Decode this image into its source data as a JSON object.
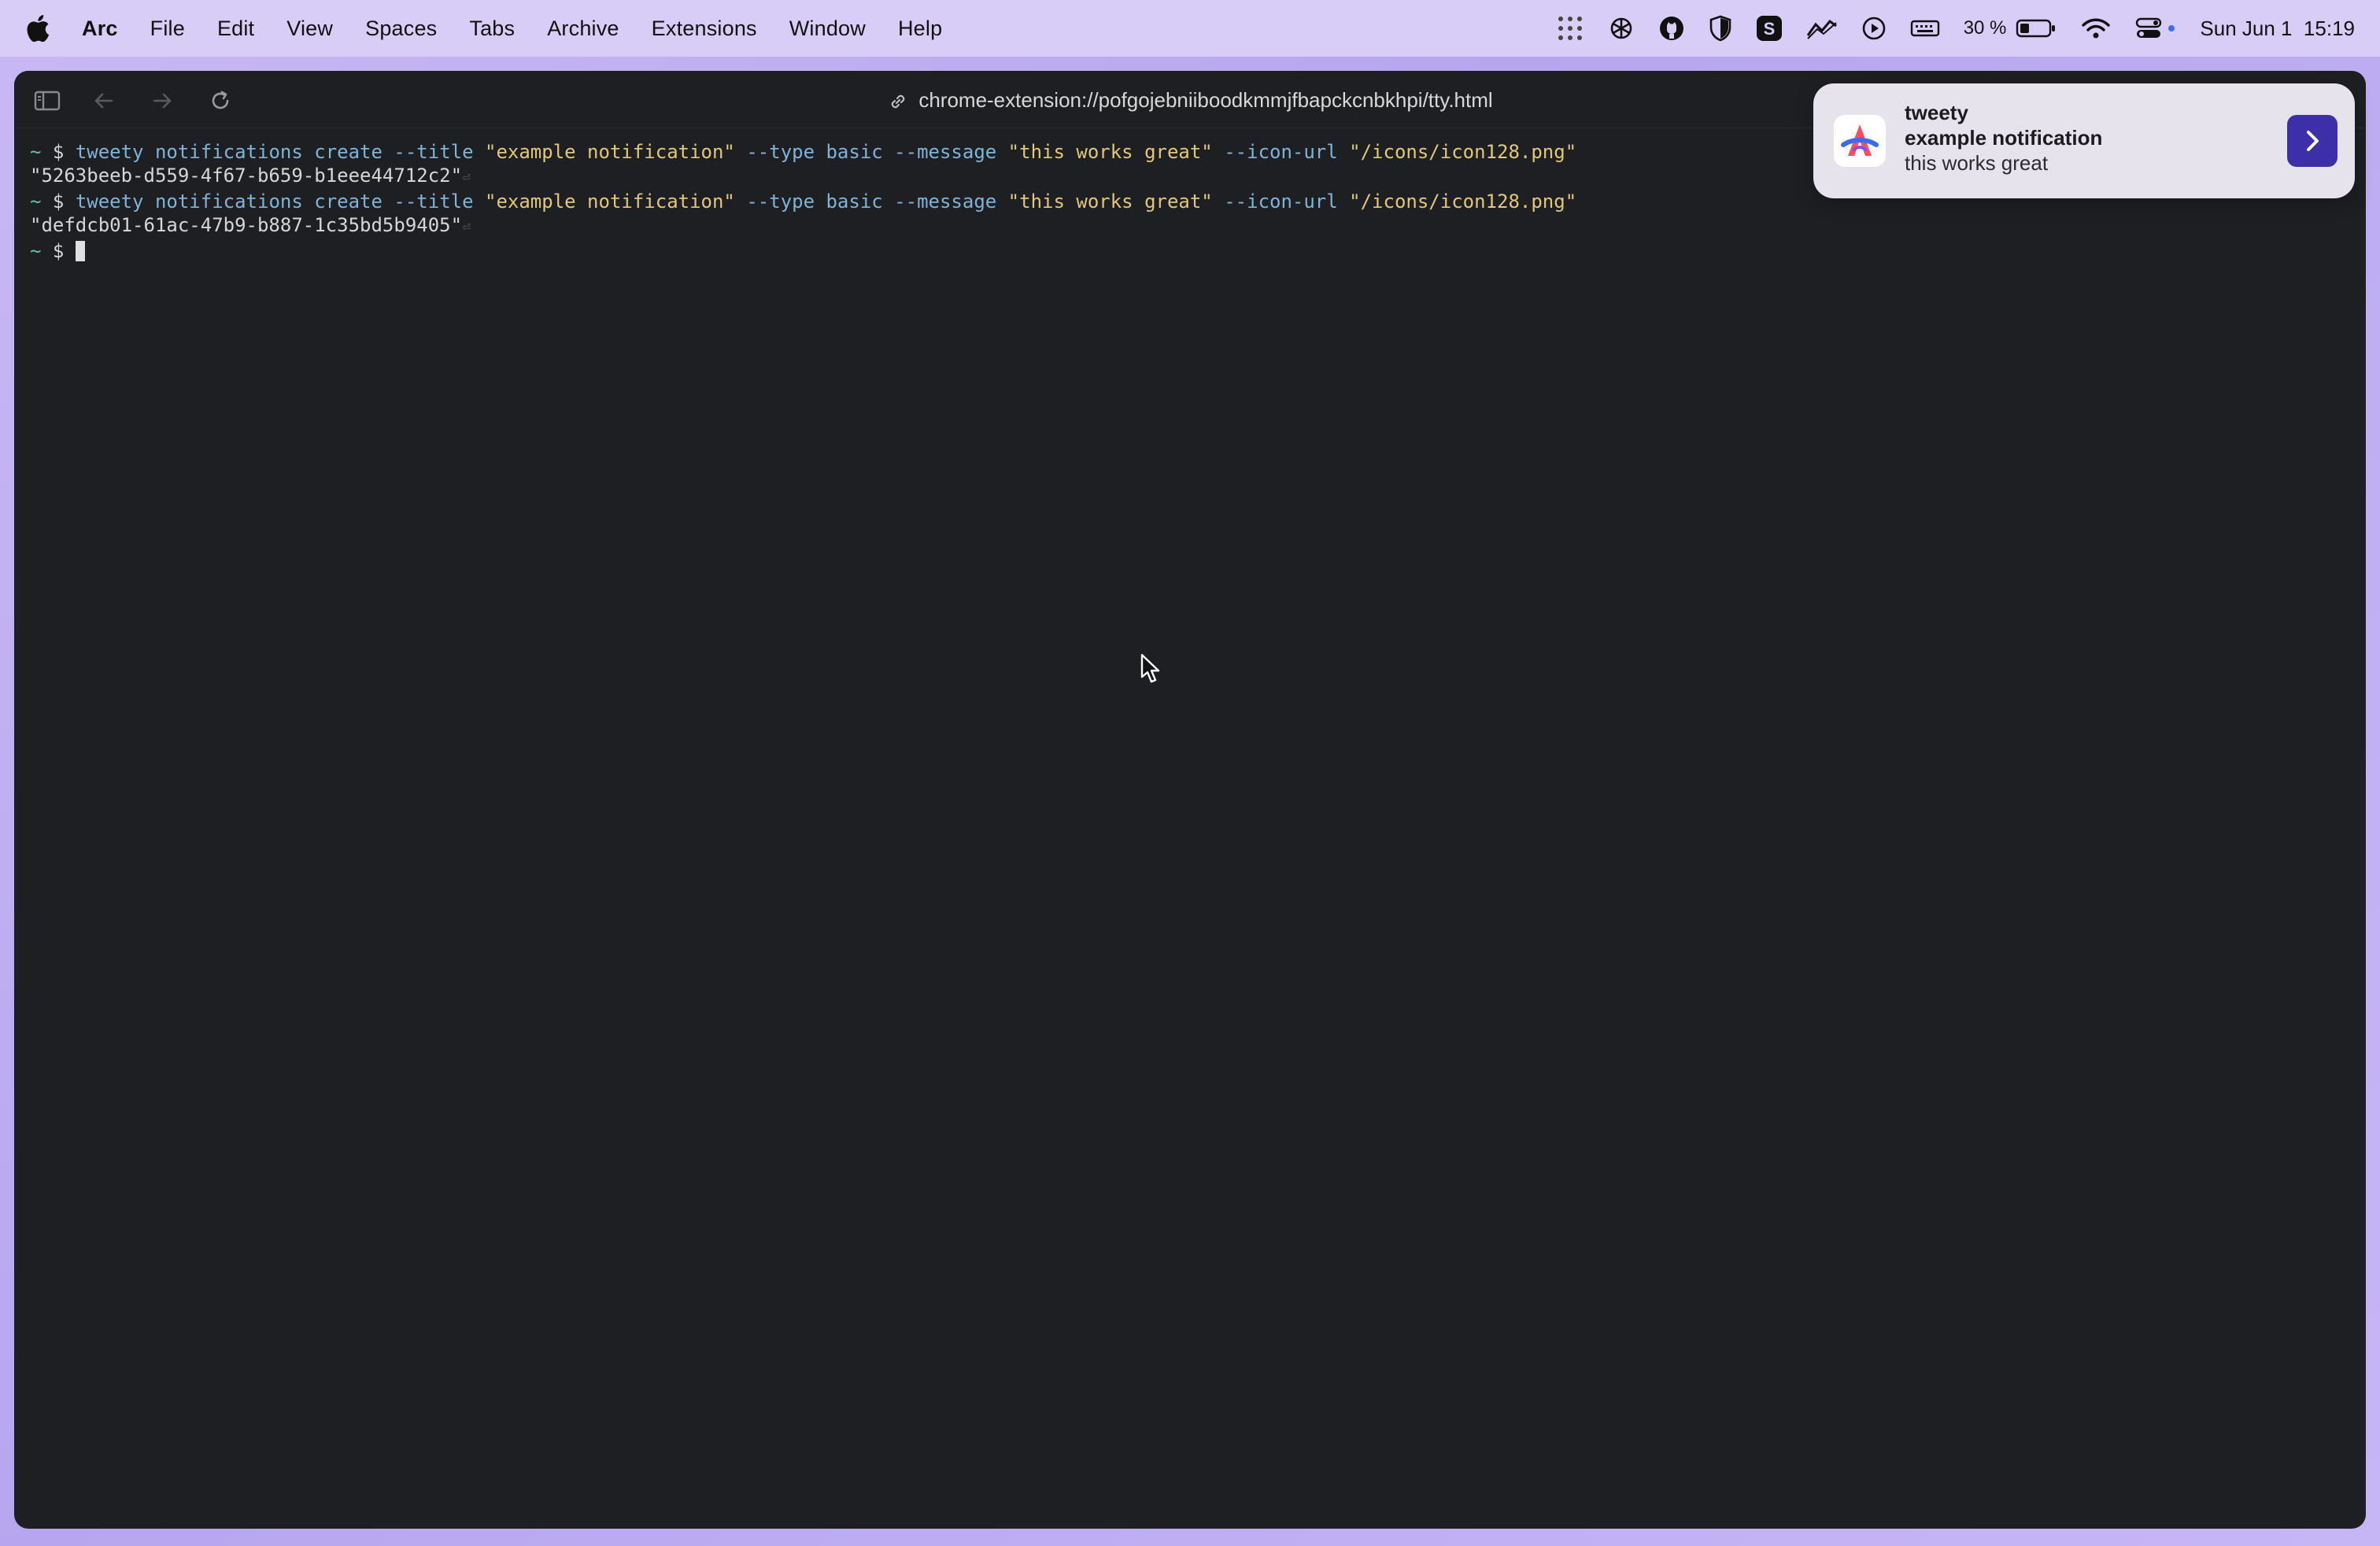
{
  "menubar": {
    "app_name": "Arc",
    "items": [
      "File",
      "Edit",
      "View",
      "Spaces",
      "Tabs",
      "Archive",
      "Extensions",
      "Window",
      "Help"
    ],
    "battery_percent": "30 %",
    "datetime": "Sun Jun 1  15:19"
  },
  "browser": {
    "url": "chrome-extension://pofgojebniiboodkmmjfbapckcnbkhpi/tty.html"
  },
  "terminal": {
    "prompt": "~ $",
    "lines": [
      {
        "command": "tweety notifications create --title",
        "args": [
          {
            "str": "\"example notification\"",
            "flag": " --type basic --message "
          },
          {
            "str": "\"this works great\"",
            "flag": " --icon-url "
          },
          {
            "str": "\"/icons/icon128.png\"",
            "flag": ""
          }
        ],
        "output": "\"5263beeb-d559-4f67-b659-b1eee44712c2\""
      },
      {
        "command": "tweety notifications create --title",
        "args": [
          {
            "str": "\"example notification\"",
            "flag": " --type basic --message "
          },
          {
            "str": "\"this works great\"",
            "flag": " --icon-url "
          },
          {
            "str": "\"/icons/icon128.png\"",
            "flag": ""
          }
        ],
        "output": "\"defdcb01-61ac-47b9-b887-1c35bd5b9405\""
      }
    ],
    "return_glyph": "⏎"
  },
  "notification": {
    "app": "tweety",
    "title": "example notification",
    "message": "this works great"
  },
  "colors": {
    "terminal_bg": "#1e1f22",
    "prompt": "#5ec4a8",
    "command": "#7fb3d8",
    "string": "#e2c77a",
    "notification_action": "#3d2fa8"
  }
}
